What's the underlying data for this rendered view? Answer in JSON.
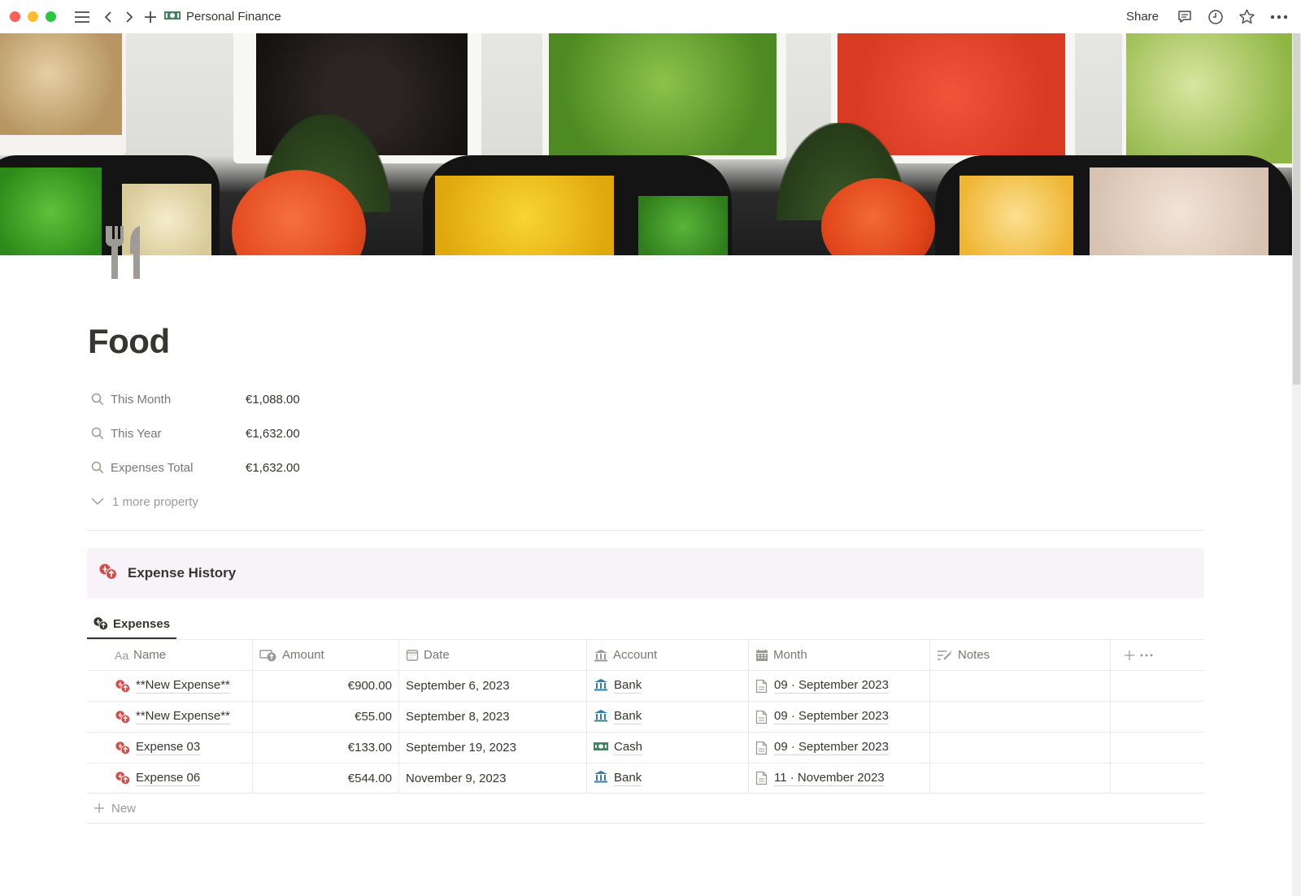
{
  "window": {
    "breadcrumb": "Personal Finance",
    "breadcrumb_icon": "money-icon",
    "share_label": "Share",
    "icons": [
      "sidebar-menu-icon",
      "back-icon",
      "forward-icon",
      "new-page-icon",
      "comments-icon",
      "history-icon",
      "favorite-star-icon",
      "more-icon"
    ]
  },
  "page": {
    "icon": "fork-knife-icon",
    "title": "Food",
    "cover": "food-platter-photo"
  },
  "properties": [
    {
      "icon": "search-icon",
      "name": "This Month",
      "value": "€1,088.00"
    },
    {
      "icon": "search-icon",
      "name": "This Year",
      "value": "€1,632.00"
    },
    {
      "icon": "search-icon",
      "name": "Expenses Total",
      "value": "€1,632.00"
    }
  ],
  "more_properties_label": "1 more property",
  "callout": {
    "icon": "expense-coins-icon",
    "title": "Expense History",
    "background": "#f8f3f8"
  },
  "database": {
    "tab_label": "Expenses",
    "columns": [
      {
        "icon": "text-type-icon",
        "icon_text": "Aa",
        "label": "Name"
      },
      {
        "icon": "currency-icon",
        "label": "Amount"
      },
      {
        "icon": "calendar-icon",
        "label": "Date"
      },
      {
        "icon": "bank-icon",
        "label": "Account"
      },
      {
        "icon": "calendar-grid-icon",
        "label": "Month"
      },
      {
        "icon": "notes-edit-icon",
        "label": "Notes"
      }
    ],
    "rows": [
      {
        "name": "**New Expense**",
        "amount": "€900.00",
        "date": "September 6, 2023",
        "account": "Bank",
        "account_icon": "bank-icon",
        "month": "09 · September 2023",
        "notes": ""
      },
      {
        "name": "**New Expense**",
        "amount": "€55.00",
        "date": "September 8, 2023",
        "account": "Bank",
        "account_icon": "bank-icon",
        "month": "09 · September 2023",
        "notes": ""
      },
      {
        "name": "Expense 03",
        "amount": "€133.00",
        "date": "September 19, 2023",
        "account": "Cash",
        "account_icon": "cash-icon",
        "month": "09 · September 2023",
        "notes": ""
      },
      {
        "name": "Expense 06",
        "amount": "€544.00",
        "date": "November 9, 2023",
        "account": "Bank",
        "account_icon": "bank-icon",
        "month": "11 · November 2023",
        "notes": ""
      }
    ],
    "new_label": "New"
  },
  "colors": {
    "expense_icon": "#d44c47",
    "bank_icon": "#337ea9",
    "cash_icon": "#448361",
    "text": "#37352f",
    "muted": "#787774"
  }
}
